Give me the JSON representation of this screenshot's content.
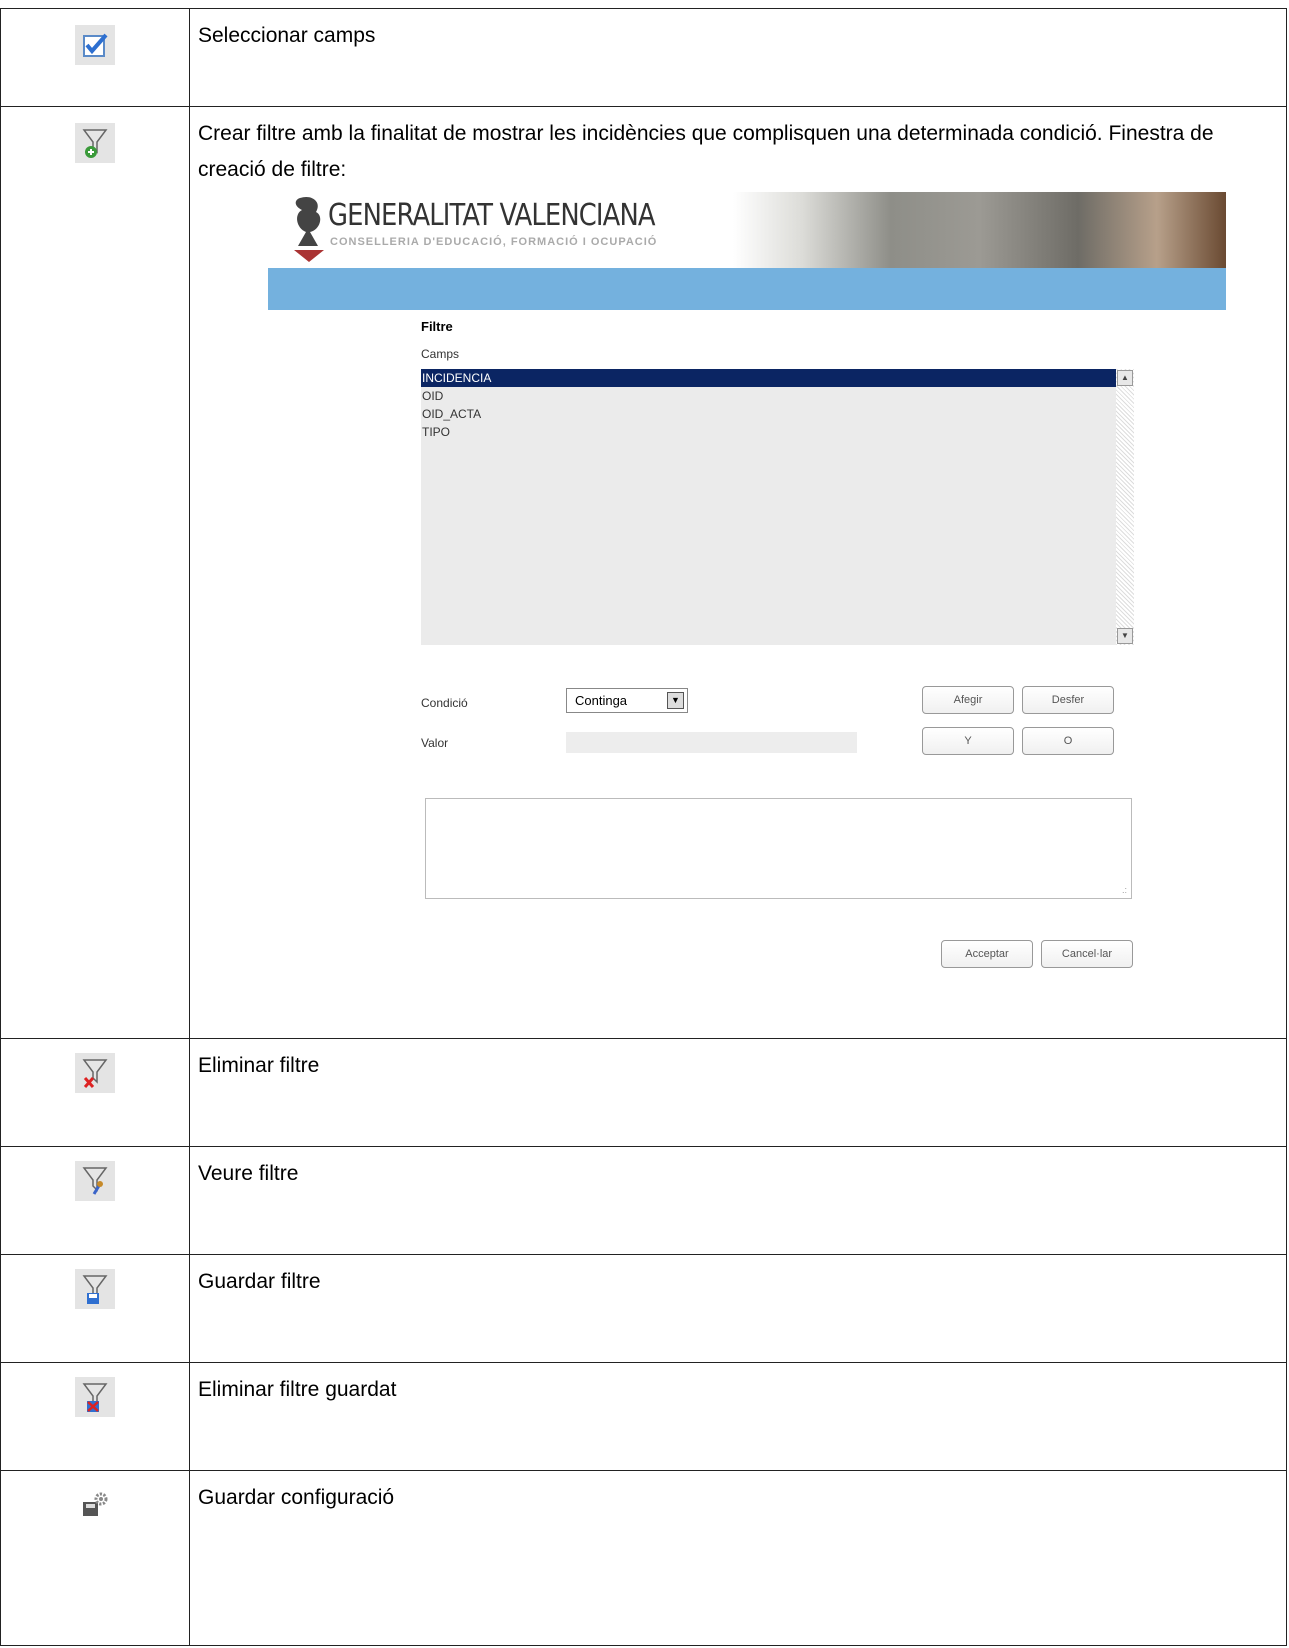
{
  "rows": [
    {
      "icon": "check-icon",
      "text": "Seleccionar camps"
    },
    {
      "icon": "filter-add-icon",
      "text": "Crear filtre amb la finalitat de    mostrar les incidències que complisquen una determinada condició. Finestra de creació de filtre:"
    },
    {
      "icon": "filter-delete-icon",
      "text": "Eliminar filtre"
    },
    {
      "icon": "filter-view-icon",
      "text": "Veure filtre"
    },
    {
      "icon": "filter-save-icon",
      "text": "Guardar filtre"
    },
    {
      "icon": "filter-delete-saved-icon",
      "text": "Eliminar filtre guardat"
    },
    {
      "icon": "save-config-icon",
      "text": "Guardar configuració"
    }
  ],
  "screenshot": {
    "logo": {
      "title": "GENERALITAT VALENCIANA",
      "subtitle": "CONSELLERIA D'EDUCACIÓ, FORMACIÓ I OCUPACIÓ"
    },
    "title": "Filtre",
    "fields_label": "Camps",
    "fields": [
      "INCIDENCIA",
      "OID",
      "OID_ACTA",
      "TIPO"
    ],
    "selected_field": "INCIDENCIA",
    "condition_label": "Condició",
    "condition_value": "Continga",
    "value_label": "Valor",
    "buttons": {
      "add": "Afegir",
      "undo": "Desfer",
      "and": "Y",
      "or": "O",
      "accept": "Acceptar",
      "cancel": "Cancel·lar"
    },
    "colors": {
      "banner_bar": "#74b1de",
      "selection": "#0b2563"
    }
  }
}
